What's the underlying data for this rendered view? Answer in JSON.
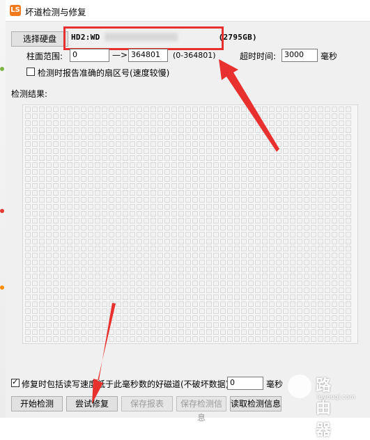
{
  "window": {
    "title": "坏道检测与修复",
    "app_icon": "LS"
  },
  "disk": {
    "select_button": "选择硬盘",
    "name_prefix": "HD2:WD",
    "name_suffix": "(2795GB)"
  },
  "range": {
    "label": "柱面范围:",
    "start": "0",
    "arrow": "—>",
    "end": "364801",
    "hint": "(0-364801)"
  },
  "timeout": {
    "label": "超时时间:",
    "value": "3000",
    "unit": "毫秒"
  },
  "options": {
    "report_sector_label": "检测时报告准确的扇区号(速度较慢)",
    "report_sector_checked": false
  },
  "results": {
    "label": "检测结果:"
  },
  "repair": {
    "checkbox_label": "修复时包括读写速度低于此毫秒数的好磁道(不破坏数据):",
    "checked": true,
    "value": "0",
    "unit": "毫秒"
  },
  "buttons": {
    "start": "开始检测",
    "repair": "尝试修复",
    "save_report": "保存报表",
    "save_info": "保存检测信息",
    "load_info": "读取检测信息"
  },
  "watermark": {
    "title": "路由器",
    "sub": "luyouqi.com"
  },
  "colors": {
    "highlight": "#e8302e",
    "arrow": "#e8302e"
  }
}
